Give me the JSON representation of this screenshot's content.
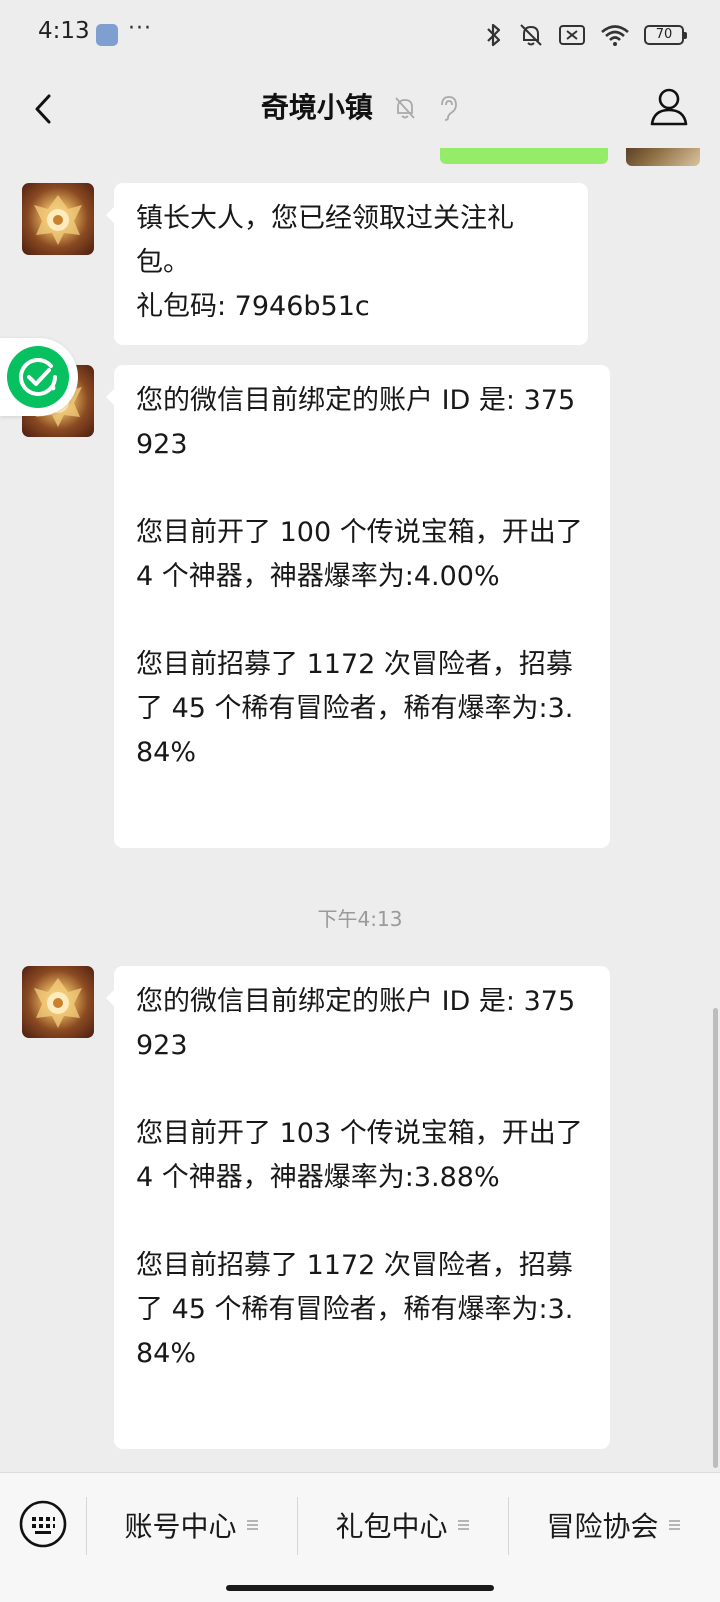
{
  "status_bar": {
    "time": "4:13",
    "more": "···",
    "battery": "70"
  },
  "header": {
    "title": "奇境小镇"
  },
  "messages": [
    {
      "text": "镇长大人，您已经领取过关注礼包。\n礼包码: 7946b51c"
    },
    {
      "text": "您的微信目前绑定的账户 ID 是: 375923\n\n您目前开了 100 个传说宝箱，开出了 4 个神器，神器爆率为:4.00%\n\n您目前招募了 1172 次冒险者，招募了 45 个稀有冒险者，稀有爆率为:3.84%\n"
    },
    {
      "text": "您的微信目前绑定的账户 ID 是: 375923\n\n您目前开了 103 个传说宝箱，开出了 4 个神器，神器爆率为:3.88%\n\n您目前招募了 1172 次冒险者，招募了 45 个稀有冒险者，稀有爆率为:3.84%\n"
    }
  ],
  "time_divider": "下午4:13",
  "menu": {
    "items": [
      {
        "label": "账号中心"
      },
      {
        "label": "礼包中心"
      },
      {
        "label": "冒险协会"
      }
    ]
  },
  "icons": {
    "back": "chevron-left-icon",
    "mute": "bell-off-icon",
    "ear": "ear-icon",
    "profile": "person-icon",
    "keyboard": "keyboard-icon",
    "float": "check-circle-icon"
  },
  "colors": {
    "background": "#ededed",
    "bubble": "#ffffff",
    "sent_bubble": "#95ec69",
    "float_green": "#07c160"
  }
}
